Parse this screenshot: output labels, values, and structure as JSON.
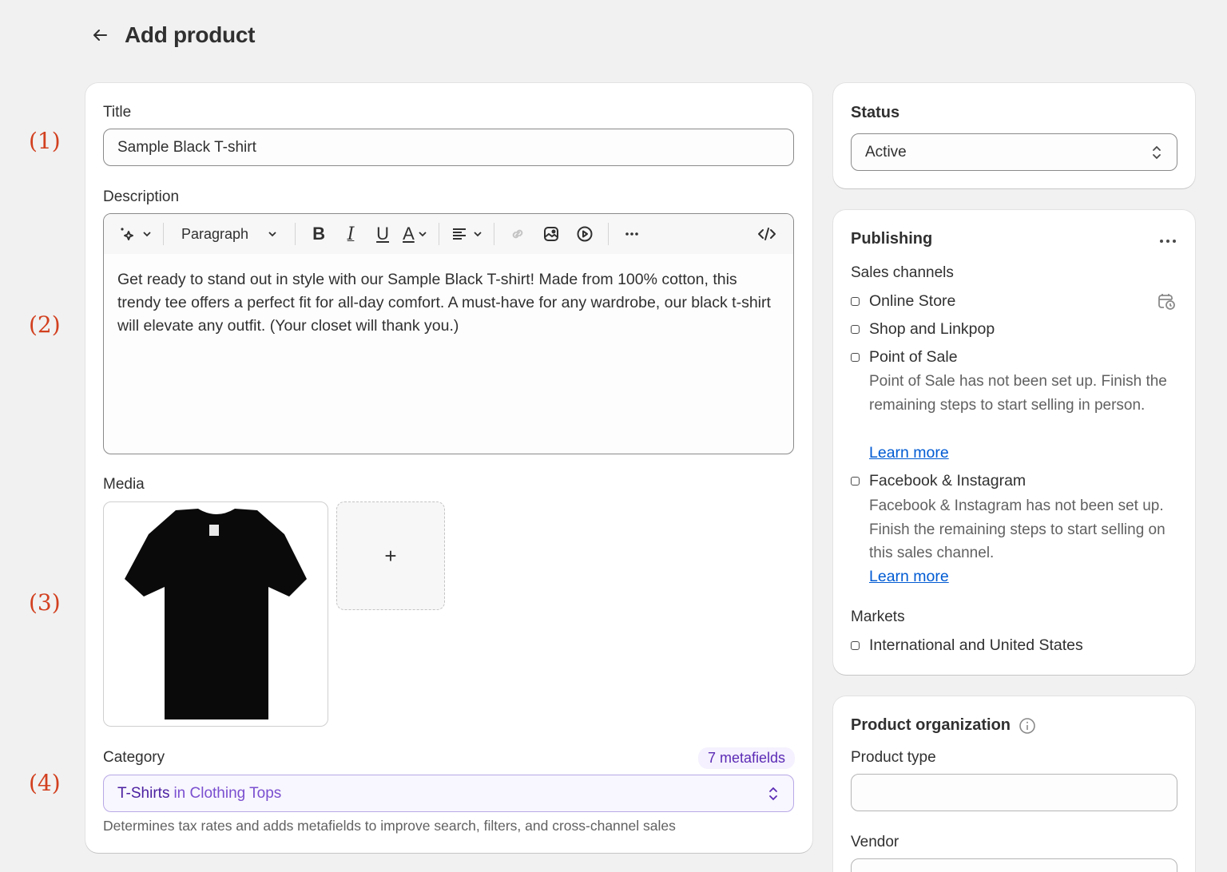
{
  "page": {
    "title": "Add product",
    "back_icon": "arrow-left-icon"
  },
  "annotations": [
    "(1)",
    "(2)",
    "(3)",
    "(4)"
  ],
  "product": {
    "title_label": "Title",
    "title_value": "Sample Black T-shirt",
    "description_label": "Description",
    "toolbar": {
      "ai_icon": "sparkle-icon",
      "paragraph_label": "Paragraph",
      "bold": "B",
      "italic": "I",
      "underline": "U",
      "text_color": "A",
      "align_icon": "align-left-icon",
      "link_icon": "link-icon",
      "image_icon": "image-icon",
      "video_icon": "play-circle-icon",
      "more_icon": "more-horizontal-icon",
      "code_icon": "code-icon"
    },
    "description_text": "Get ready to stand out in style with our Sample Black T-shirt! Made from 100% cotton, this trendy tee offers a perfect fit for all-day comfort. A must-have for any wardrobe, our black t-shirt will elevate any outfit. (Your closet will thank you.)",
    "media_label": "Media",
    "media_items": [
      {
        "alt": "Black T-shirt"
      }
    ],
    "add_media_label": "+",
    "category_label": "Category",
    "metafields_badge": "7 metafields",
    "category_value_main": "T-Shirts",
    "category_value_rest": "in Clothing Tops",
    "category_help": "Determines tax rates and adds metafields to improve search, filters, and cross-channel sales"
  },
  "status": {
    "title": "Status",
    "value": "Active"
  },
  "publishing": {
    "title": "Publishing",
    "sales_channels_label": "Sales channels",
    "channels": [
      {
        "name": "Online Store",
        "has_schedule_icon": true
      },
      {
        "name": "Shop and Linkpop"
      },
      {
        "name": "Point of Sale",
        "description": "Point of Sale has not been set up. Finish the remaining steps to start selling in person.",
        "link": "Learn more"
      },
      {
        "name": "Facebook & Instagram",
        "description": "Facebook & Instagram has not been set up. Finish the remaining steps to start selling on this sales channel.",
        "link": "Learn more"
      }
    ],
    "markets_label": "Markets",
    "markets": [
      "International and United States"
    ]
  },
  "organization": {
    "title": "Product organization",
    "product_type_label": "Product type",
    "product_type_value": "",
    "vendor_label": "Vendor",
    "vendor_value": ""
  },
  "colors": {
    "accent_purple": "#5b2bb5",
    "link_blue": "#005bd3",
    "annotation_red": "#d2401f"
  }
}
